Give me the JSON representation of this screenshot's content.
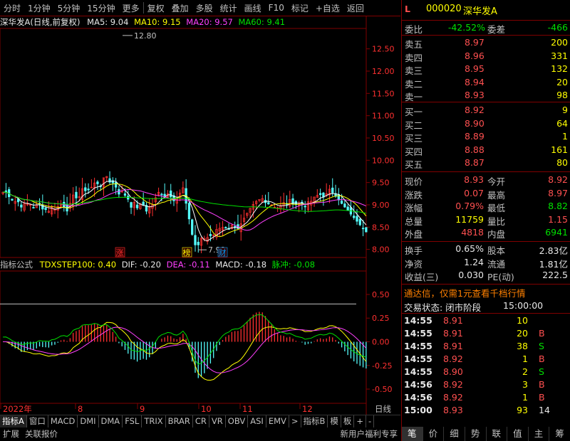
{
  "toolbar": {
    "items": [
      "分时",
      "1分钟",
      "5分钟",
      "15分钟",
      "更多",
      "复权",
      "叠加",
      "多股",
      "统计",
      "画线",
      "F10",
      "标记",
      "+自选",
      "返回"
    ]
  },
  "main_chart": {
    "title": "深华发A(日线,前复权)",
    "ma5": "MA5: 9.04",
    "ma10": "MA10: 9.15",
    "ma20": "MA20: 9.57",
    "ma60": "MA60: 9.41",
    "high_label": "12.80",
    "low_label": "7.99",
    "y_ticks": [
      "12.50",
      "12.00",
      "11.50",
      "11.00",
      "10.50",
      "10.00",
      "9.50",
      "9.00",
      "8.50",
      "8.00"
    ],
    "markers": [
      "涨",
      "榜",
      "财"
    ]
  },
  "indicator": {
    "title": "指标公式",
    "name": "TDXSTEP100: 0.40",
    "dif": "DIF: -0.20",
    "dea": "DEA: -0.11",
    "macd": "MACD: -0.18",
    "pulse": "脉冲: -0.08",
    "y_ticks": [
      "0.50",
      "0.25",
      "0.00",
      "-0.25",
      "-0.50"
    ]
  },
  "x_axis": {
    "labels": [
      "2022年",
      "8",
      "9",
      "10",
      "11",
      "12"
    ],
    "right_label": "日线"
  },
  "tabs": [
    "指标A",
    "窗口",
    "MACD",
    "DMI",
    "DMA",
    "FSL",
    "TRIX",
    "BRAR",
    "CR",
    "VR",
    "OBV",
    "ASI",
    "EMV",
    ">",
    "指标B",
    "模",
    "板",
    "+",
    "-"
  ],
  "bottom": {
    "left1": "扩展",
    "left2": "关联报价",
    "right": "新用户福利专享"
  },
  "quote": {
    "flag": "L",
    "code": "000020",
    "name": "深华发A",
    "weibi_label": "委比",
    "weibi": "-42.52%",
    "weicha_label": "委差",
    "weicha": "-466",
    "asks": [
      {
        "label": "卖五",
        "price": "8.97",
        "vol": "200"
      },
      {
        "label": "卖四",
        "price": "8.96",
        "vol": "331"
      },
      {
        "label": "卖三",
        "price": "8.95",
        "vol": "132"
      },
      {
        "label": "卖二",
        "price": "8.94",
        "vol": "20"
      },
      {
        "label": "卖一",
        "price": "8.93",
        "vol": "98"
      }
    ],
    "bids": [
      {
        "label": "买一",
        "price": "8.92",
        "vol": "9"
      },
      {
        "label": "买二",
        "price": "8.90",
        "vol": "64"
      },
      {
        "label": "买三",
        "price": "8.89",
        "vol": "1"
      },
      {
        "label": "买四",
        "price": "8.88",
        "vol": "161"
      },
      {
        "label": "买五",
        "price": "8.87",
        "vol": "80"
      }
    ],
    "stats": [
      {
        "l1": "现价",
        "v1": "8.93",
        "l2": "今开",
        "v2": "8.92",
        "c1": "red",
        "c2": "red"
      },
      {
        "l1": "涨跌",
        "v1": "0.07",
        "l2": "最高",
        "v2": "8.97",
        "c1": "red",
        "c2": "red"
      },
      {
        "l1": "涨幅",
        "v1": "0.79%",
        "l2": "最低",
        "v2": "8.82",
        "c1": "red",
        "c2": "green"
      },
      {
        "l1": "总量",
        "v1": "11759",
        "l2": "量比",
        "v2": "1.15",
        "c1": "yellow",
        "c2": "red"
      },
      {
        "l1": "外盘",
        "v1": "4818",
        "l2": "内盘",
        "v2": "6941",
        "c1": "red",
        "c2": "green"
      }
    ],
    "stats2": [
      {
        "l1": "换手",
        "v1": "0.65%",
        "l2": "股本",
        "v2": "2.83亿"
      },
      {
        "l1": "净资",
        "v1": "1.24",
        "l2": "流通",
        "v2": "1.81亿"
      },
      {
        "l1": "收益(三)",
        "v1": "0.030",
        "l2": "PE(动)",
        "v2": "222.5"
      }
    ],
    "promo": "通达信，仅需1元查看千档行情",
    "trade_status_label": "交易状态: 闭市阶段",
    "trade_status_time": "15:00:00",
    "ticks": [
      {
        "t": "14:55",
        "p": "8.91",
        "v": "10",
        "d": "",
        "pc": "red",
        "vc": "yellow",
        "dc": "white"
      },
      {
        "t": "14:55",
        "p": "8.91",
        "v": "20",
        "d": "B",
        "pc": "red",
        "vc": "yellow",
        "dc": "red"
      },
      {
        "t": "14:55",
        "p": "8.91",
        "v": "38",
        "d": "S",
        "pc": "red",
        "vc": "yellow",
        "dc": "green"
      },
      {
        "t": "14:55",
        "p": "8.92",
        "v": "1",
        "d": "B",
        "pc": "red",
        "vc": "yellow",
        "dc": "red"
      },
      {
        "t": "14:55",
        "p": "8.90",
        "v": "2",
        "d": "S",
        "pc": "red",
        "vc": "yellow",
        "dc": "green"
      },
      {
        "t": "14:56",
        "p": "8.92",
        "v": "3",
        "d": "B",
        "pc": "red",
        "vc": "yellow",
        "dc": "red"
      },
      {
        "t": "14:56",
        "p": "8.92",
        "v": "1",
        "d": "B",
        "pc": "red",
        "vc": "yellow",
        "dc": "red"
      },
      {
        "t": "15:00",
        "p": "8.93",
        "v": "93",
        "d": "14",
        "pc": "red",
        "vc": "yellow",
        "dc": "white"
      }
    ],
    "bottom_tabs": [
      "笔",
      "价",
      "细",
      "势",
      "联",
      "值",
      "主",
      "筹"
    ]
  }
}
